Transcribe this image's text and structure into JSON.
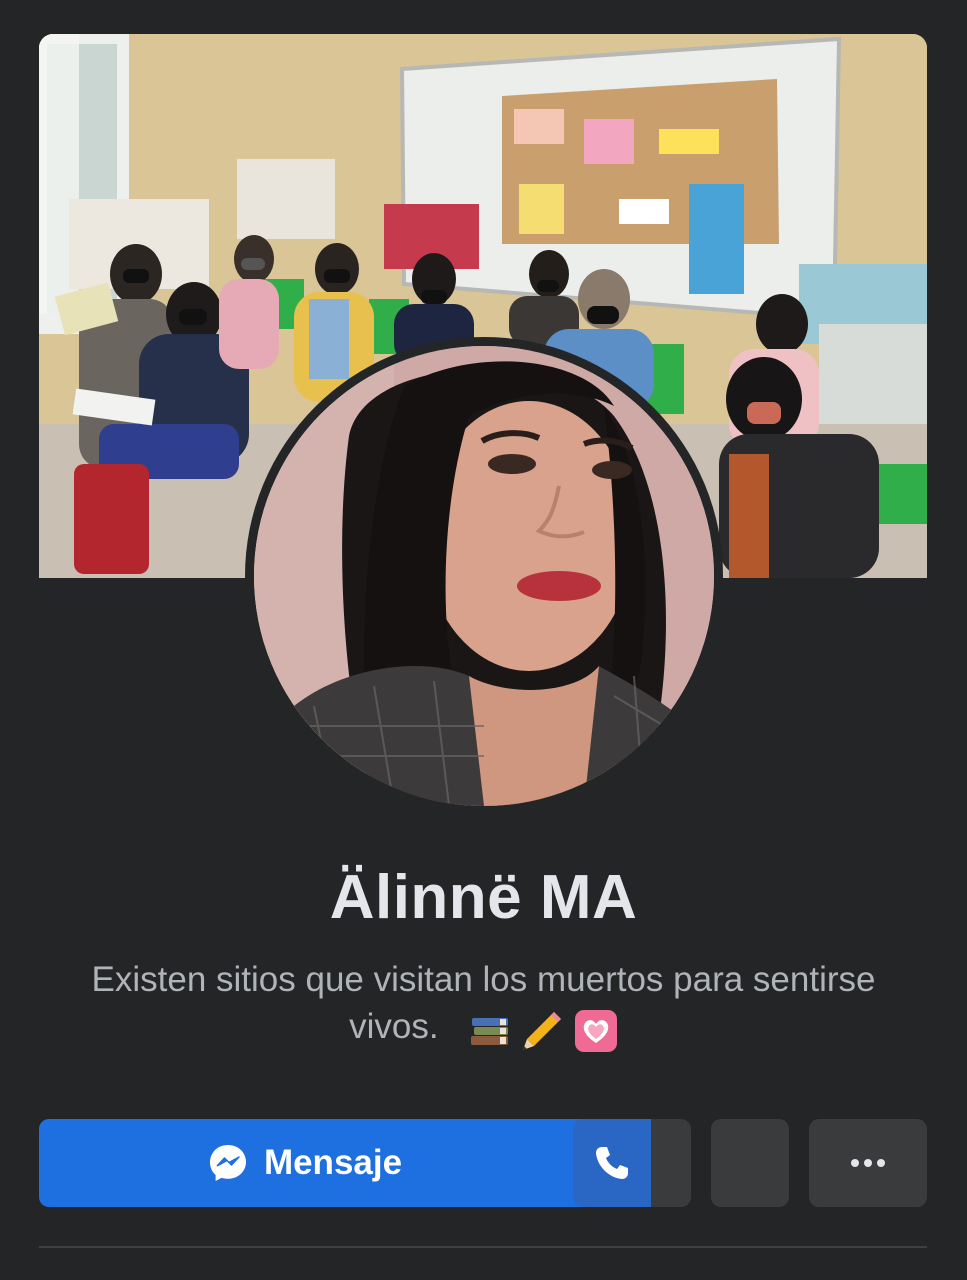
{
  "profile": {
    "name": "Älinnë MA",
    "bio": "Existen sitios que visitan los muertos para sentirse vivos.",
    "bio_emojis": [
      "books-emoji",
      "pencil-emoji",
      "heart-emoji"
    ]
  },
  "actions": {
    "message_label": "Mensaje",
    "message_icon": "messenger-icon",
    "call_icon": "phone-icon",
    "more_icon": "more-horizontal-icon"
  },
  "colors": {
    "background": "#242526",
    "primary_button": "#1e6fe0",
    "secondary_button": "#3a3b3c",
    "text_primary": "#e4e6eb",
    "text_secondary": "#b0b3b8"
  }
}
